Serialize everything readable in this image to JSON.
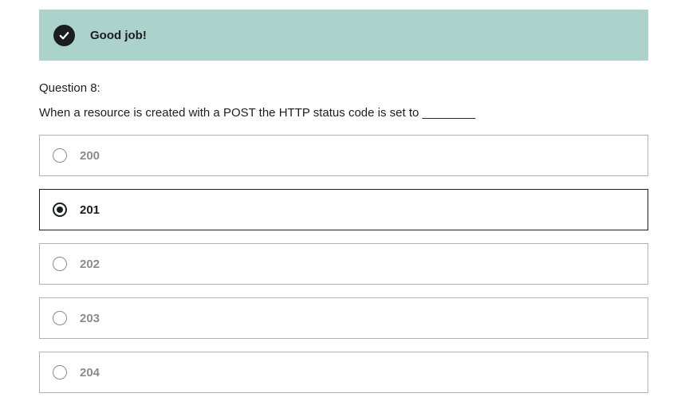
{
  "feedback": {
    "icon": "check-icon",
    "message": "Good job!",
    "background_color": "#acd2cc"
  },
  "question": {
    "label": "Question 8:",
    "text": "When a resource is created with a POST the HTTP status code is set to ________"
  },
  "options": [
    {
      "label": "200",
      "selected": false
    },
    {
      "label": "201",
      "selected": true
    },
    {
      "label": "202",
      "selected": false
    },
    {
      "label": "203",
      "selected": false
    },
    {
      "label": "204",
      "selected": false
    }
  ]
}
